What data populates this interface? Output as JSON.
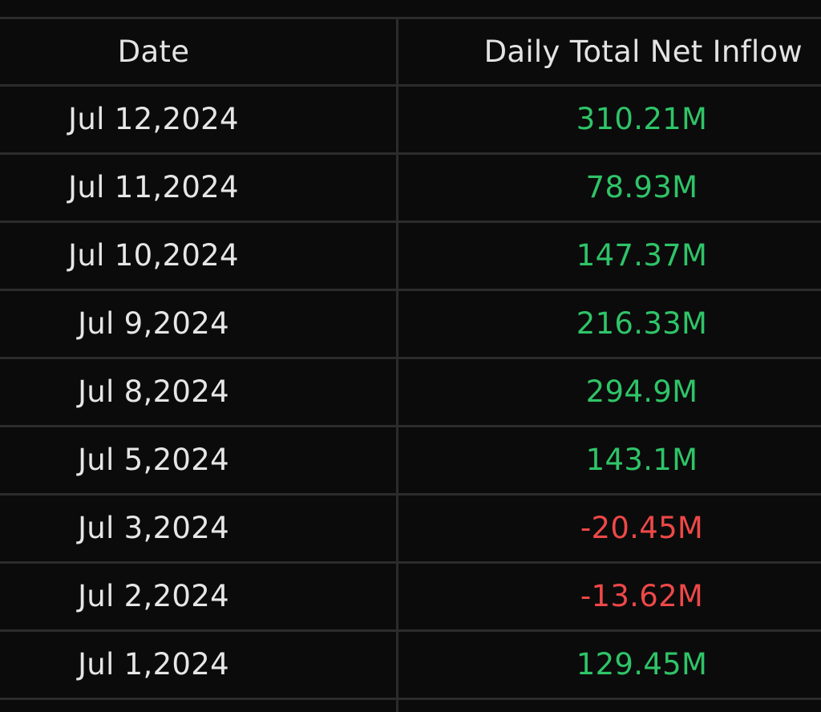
{
  "table": {
    "headers": {
      "date": "Date",
      "inflow": "Daily Total Net Inflow"
    },
    "rows": [
      {
        "date": "Jul 12,2024",
        "value": "310.21M",
        "sign": "positive"
      },
      {
        "date": "Jul 11,2024",
        "value": "78.93M",
        "sign": "positive"
      },
      {
        "date": "Jul 10,2024",
        "value": "147.37M",
        "sign": "positive"
      },
      {
        "date": "Jul 9,2024",
        "value": "216.33M",
        "sign": "positive"
      },
      {
        "date": "Jul 8,2024",
        "value": "294.9M",
        "sign": "positive"
      },
      {
        "date": "Jul 5,2024",
        "value": "143.1M",
        "sign": "positive"
      },
      {
        "date": "Jul 3,2024",
        "value": "-20.45M",
        "sign": "negative"
      },
      {
        "date": "Jul 2,2024",
        "value": "-13.62M",
        "sign": "negative"
      },
      {
        "date": "Jul 1,2024",
        "value": "129.45M",
        "sign": "positive"
      }
    ]
  },
  "colors": {
    "positive": "#2fc468",
    "negative": "#ee4848",
    "background": "#0b0b0b",
    "gridline": "#2c2c2c"
  }
}
